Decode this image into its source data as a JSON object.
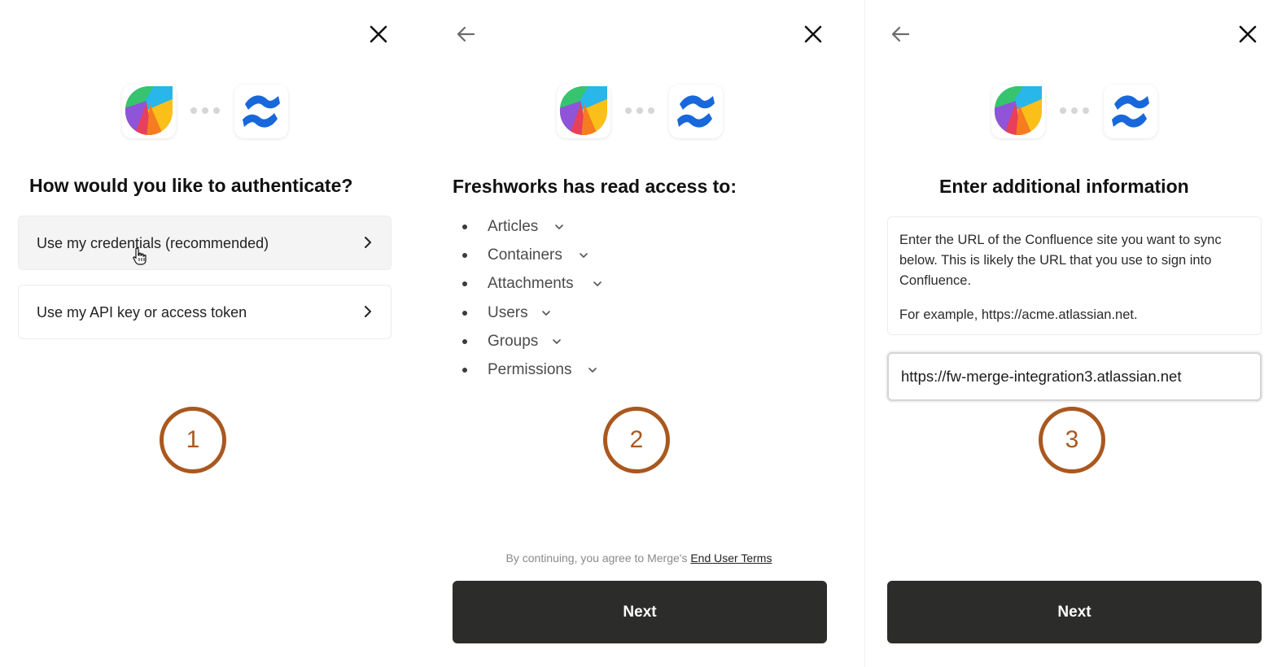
{
  "colors": {
    "accent_step": "#a9581f",
    "next_button_bg": "#2c2c2a",
    "confluence_blue": "#1868db"
  },
  "panels": [
    {
      "has_back": false,
      "title": "How would you like to authenticate?",
      "options": [
        {
          "label": "Use my credentials (recommended)",
          "hovered": true
        },
        {
          "label": "Use my API key or access token",
          "hovered": false
        }
      ],
      "step_number": "1"
    },
    {
      "has_back": true,
      "title": "Freshworks has read access to:",
      "permissions": [
        "Articles",
        "Containers",
        "Attachments",
        "Users",
        "Groups",
        "Permissions"
      ],
      "step_number": "2",
      "terms_prefix": "By continuing, you agree to Merge's ",
      "terms_link": "End User Terms",
      "next_label": "Next"
    },
    {
      "has_back": true,
      "title": "Enter additional information",
      "info_paragraph_1": "Enter the URL of the Confluence site you want to sync below. This is likely the URL that you use to sign into Confluence.",
      "info_paragraph_2": "For example, https://acme.atlassian.net.",
      "url_value": "https://fw-merge-integration3.atlassian.net",
      "step_number": "3",
      "next_label": "Next"
    }
  ],
  "icons": {
    "close": "close-icon",
    "back": "arrow-left-icon",
    "chevron": "chevron-right-icon",
    "caret": "chevron-down-icon",
    "cursor": "hand-pointer-icon",
    "logo_left": "freshworks-logo",
    "logo_right": "confluence-logo"
  }
}
